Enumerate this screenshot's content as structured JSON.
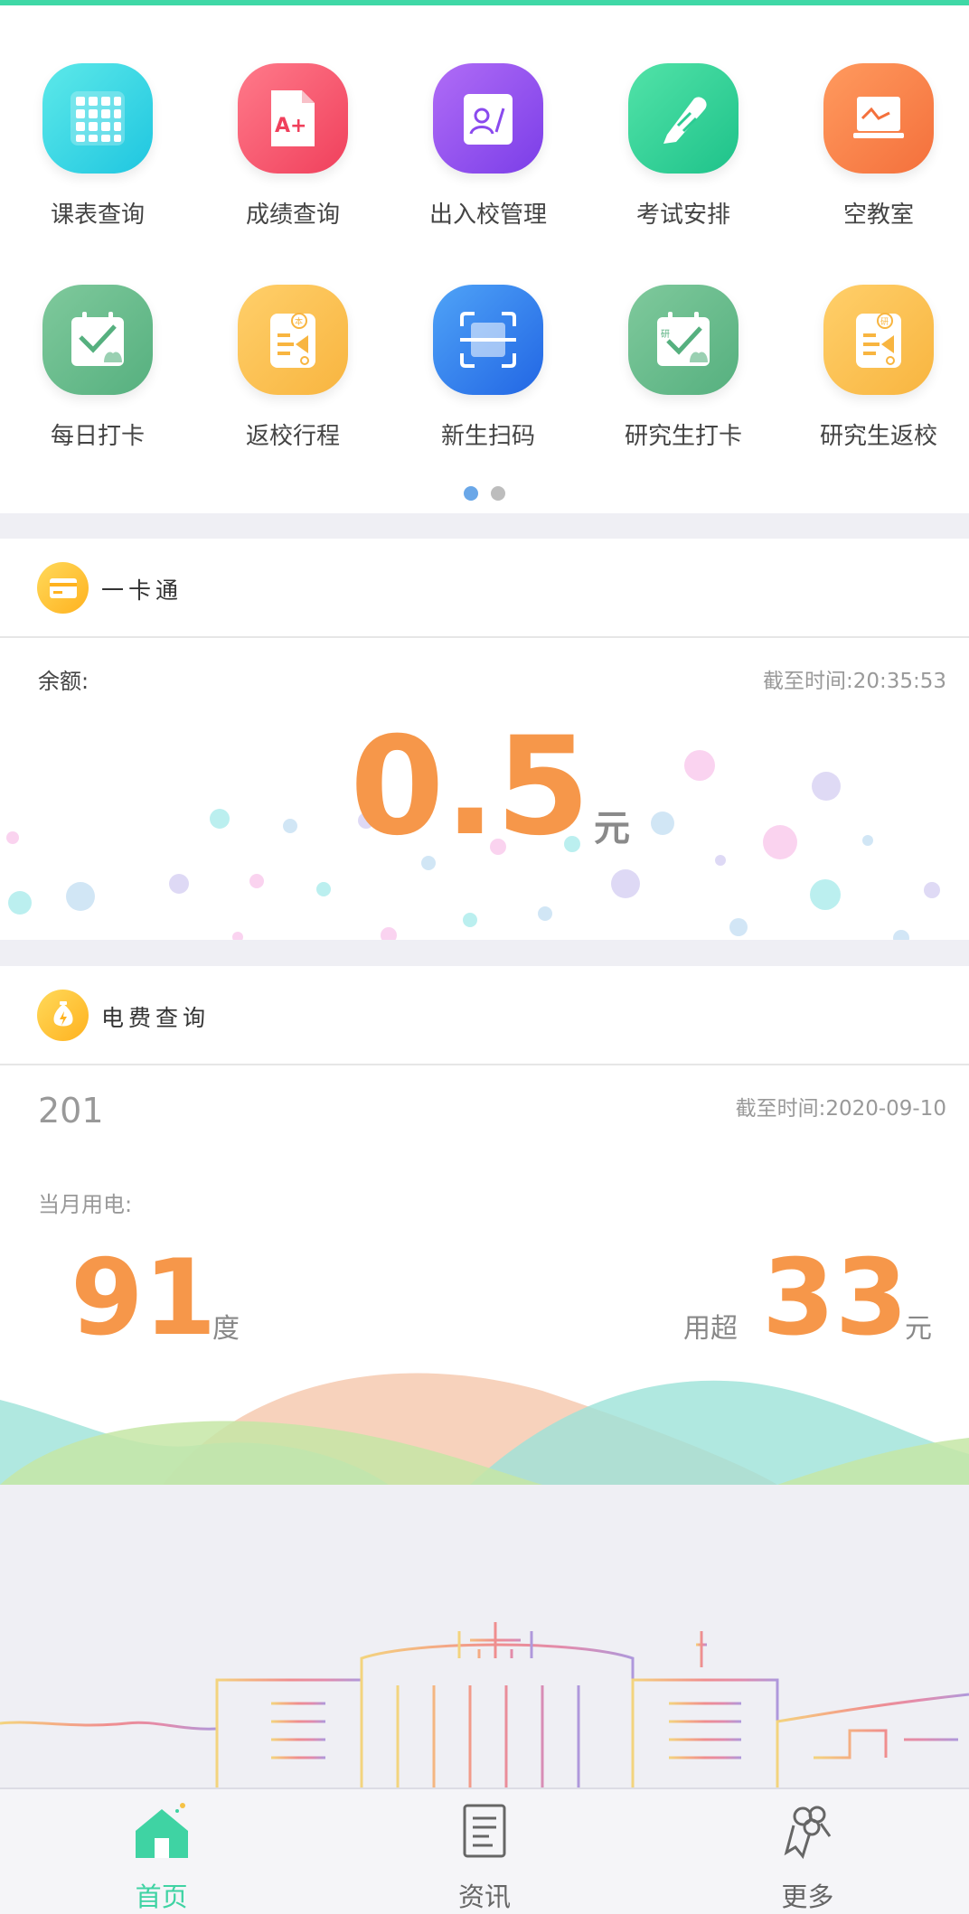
{
  "grid": {
    "items": [
      {
        "label": "课表查询",
        "icon": "timetable-icon"
      },
      {
        "label": "成绩查询",
        "icon": "grade-icon"
      },
      {
        "label": "出入校管理",
        "icon": "campus-access-icon"
      },
      {
        "label": "考试安排",
        "icon": "exam-icon"
      },
      {
        "label": "空教室",
        "icon": "empty-classroom-icon"
      },
      {
        "label": "每日打卡",
        "icon": "daily-checkin-icon"
      },
      {
        "label": "返校行程",
        "icon": "return-trip-icon"
      },
      {
        "label": "新生扫码",
        "icon": "scan-icon"
      },
      {
        "label": "研究生打卡",
        "icon": "grad-checkin-icon"
      },
      {
        "label": "研究生返校",
        "icon": "grad-return-icon"
      }
    ],
    "page_index": 1,
    "page_count": 2
  },
  "campus_card": {
    "title": "一卡通",
    "balance_label": "余额:",
    "time_label": "截至时间:20:35:53",
    "balance": "0.5",
    "unit": "元"
  },
  "electricity": {
    "title": "电费查询",
    "room": "201",
    "time_label": "截至时间:2020-09-10",
    "month_label": "当月用电:",
    "usage": "91",
    "usage_unit": "度",
    "over_label": "用超",
    "over_amount": "33",
    "over_unit": "元"
  },
  "nav": {
    "items": [
      {
        "label": "首页",
        "icon": "home-icon",
        "active": true
      },
      {
        "label": "资讯",
        "icon": "news-icon",
        "active": false
      },
      {
        "label": "更多",
        "icon": "more-icon",
        "active": false
      }
    ]
  },
  "colors": {
    "accent": "#3fd8a6",
    "orange": "#f6974a",
    "nav_active": "#3fd3a3"
  }
}
